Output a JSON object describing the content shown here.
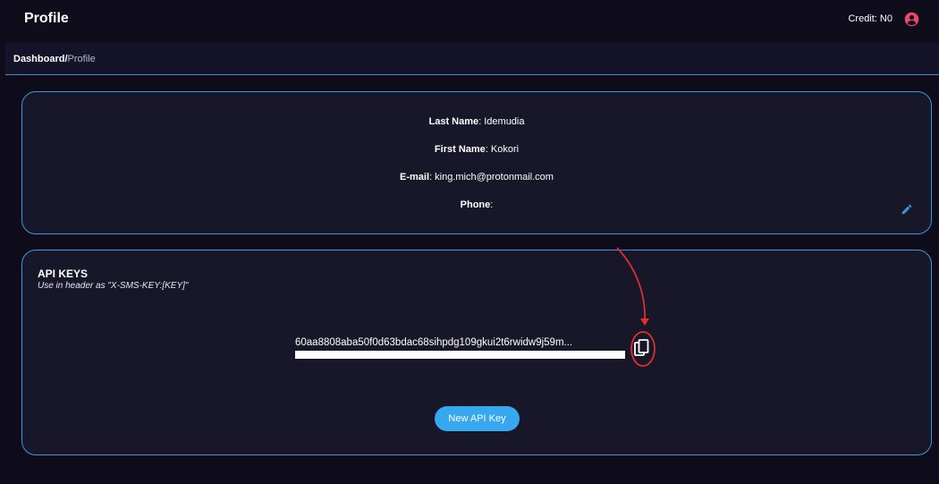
{
  "header": {
    "title": "Profile",
    "credit": "Credit: N0",
    "user_icon": "user-circle-icon"
  },
  "breadcrumb": {
    "dashboard": "Dashboard",
    "separator": "/",
    "current": "Profile"
  },
  "profile": {
    "last_name": {
      "label": "Last Name",
      "value": ": Idemudia"
    },
    "first_name": {
      "label": "First Name",
      "value": ": Kokori"
    },
    "email": {
      "label": "E-mail",
      "value": ": king.mich@protonmail.com"
    },
    "phone": {
      "label": "Phone",
      "value": ":"
    },
    "edit_icon": "pencil-icon"
  },
  "api_keys": {
    "title": "API KEYS",
    "subtitle": "Use in header as \"X-SMS-KEY:[KEY]\"",
    "key_value": "60aa8808aba50f0d63bdac68sihpdg109gkui2t6rwidw9j59m...",
    "copy_icon": "copy-icon",
    "new_key_button": "New API Key"
  },
  "colors": {
    "background": "#0e0b1a",
    "card_border": "#3a98d4",
    "accent_button": "#37a7ef",
    "user_icon": "#e8466c",
    "annotation": "#d9312b"
  }
}
